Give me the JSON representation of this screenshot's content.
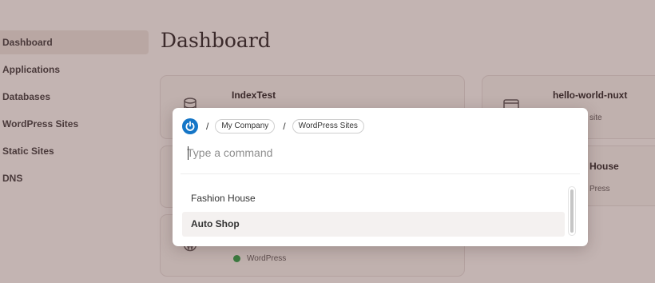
{
  "sidebar": {
    "items": [
      {
        "label": "Dashboard",
        "active": true
      },
      {
        "label": "Applications"
      },
      {
        "label": "Databases"
      },
      {
        "label": "WordPress Sites"
      },
      {
        "label": "Static Sites"
      },
      {
        "label": "DNS"
      }
    ]
  },
  "page": {
    "title": "Dashboard"
  },
  "cards": {
    "index_test": {
      "title": "IndexTest",
      "icon": "database-icon"
    },
    "hello_world": {
      "title": "hello-world-nuxt",
      "sub_partial": "site",
      "icon": "static-site-icon"
    },
    "fashion": {
      "title_partial": "House",
      "sub_partial": "Press"
    },
    "wordpress": {
      "status_label": "WordPress",
      "status_color": "#3b7a3f",
      "icon": "wordpress-icon"
    }
  },
  "palette": {
    "logo_icon": "power-logo-icon",
    "breadcrumbs": [
      "My Company",
      "WordPress Sites"
    ],
    "separator": "/",
    "placeholder": "Type a command",
    "results": [
      {
        "label": "Fashion House",
        "selected": false
      },
      {
        "label": "Auto Shop",
        "selected": true
      }
    ]
  },
  "colors": {
    "backdrop": "#c3b4b2",
    "accent": "#1576c7",
    "active_sidebar": "#b9a7a3"
  }
}
